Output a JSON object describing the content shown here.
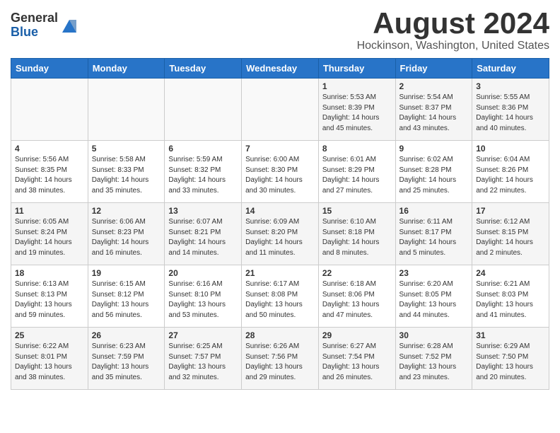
{
  "header": {
    "logo": {
      "general": "General",
      "blue": "Blue"
    },
    "title": "August 2024",
    "location": "Hockinson, Washington, United States"
  },
  "weekdays": [
    "Sunday",
    "Monday",
    "Tuesday",
    "Wednesday",
    "Thursday",
    "Friday",
    "Saturday"
  ],
  "weeks": [
    [
      {
        "day": "",
        "info": ""
      },
      {
        "day": "",
        "info": ""
      },
      {
        "day": "",
        "info": ""
      },
      {
        "day": "",
        "info": ""
      },
      {
        "day": "1",
        "info": "Sunrise: 5:53 AM\nSunset: 8:39 PM\nDaylight: 14 hours\nand 45 minutes."
      },
      {
        "day": "2",
        "info": "Sunrise: 5:54 AM\nSunset: 8:37 PM\nDaylight: 14 hours\nand 43 minutes."
      },
      {
        "day": "3",
        "info": "Sunrise: 5:55 AM\nSunset: 8:36 PM\nDaylight: 14 hours\nand 40 minutes."
      }
    ],
    [
      {
        "day": "4",
        "info": "Sunrise: 5:56 AM\nSunset: 8:35 PM\nDaylight: 14 hours\nand 38 minutes."
      },
      {
        "day": "5",
        "info": "Sunrise: 5:58 AM\nSunset: 8:33 PM\nDaylight: 14 hours\nand 35 minutes."
      },
      {
        "day": "6",
        "info": "Sunrise: 5:59 AM\nSunset: 8:32 PM\nDaylight: 14 hours\nand 33 minutes."
      },
      {
        "day": "7",
        "info": "Sunrise: 6:00 AM\nSunset: 8:30 PM\nDaylight: 14 hours\nand 30 minutes."
      },
      {
        "day": "8",
        "info": "Sunrise: 6:01 AM\nSunset: 8:29 PM\nDaylight: 14 hours\nand 27 minutes."
      },
      {
        "day": "9",
        "info": "Sunrise: 6:02 AM\nSunset: 8:28 PM\nDaylight: 14 hours\nand 25 minutes."
      },
      {
        "day": "10",
        "info": "Sunrise: 6:04 AM\nSunset: 8:26 PM\nDaylight: 14 hours\nand 22 minutes."
      }
    ],
    [
      {
        "day": "11",
        "info": "Sunrise: 6:05 AM\nSunset: 8:24 PM\nDaylight: 14 hours\nand 19 minutes."
      },
      {
        "day": "12",
        "info": "Sunrise: 6:06 AM\nSunset: 8:23 PM\nDaylight: 14 hours\nand 16 minutes."
      },
      {
        "day": "13",
        "info": "Sunrise: 6:07 AM\nSunset: 8:21 PM\nDaylight: 14 hours\nand 14 minutes."
      },
      {
        "day": "14",
        "info": "Sunrise: 6:09 AM\nSunset: 8:20 PM\nDaylight: 14 hours\nand 11 minutes."
      },
      {
        "day": "15",
        "info": "Sunrise: 6:10 AM\nSunset: 8:18 PM\nDaylight: 14 hours\nand 8 minutes."
      },
      {
        "day": "16",
        "info": "Sunrise: 6:11 AM\nSunset: 8:17 PM\nDaylight: 14 hours\nand 5 minutes."
      },
      {
        "day": "17",
        "info": "Sunrise: 6:12 AM\nSunset: 8:15 PM\nDaylight: 14 hours\nand 2 minutes."
      }
    ],
    [
      {
        "day": "18",
        "info": "Sunrise: 6:13 AM\nSunset: 8:13 PM\nDaylight: 13 hours\nand 59 minutes."
      },
      {
        "day": "19",
        "info": "Sunrise: 6:15 AM\nSunset: 8:12 PM\nDaylight: 13 hours\nand 56 minutes."
      },
      {
        "day": "20",
        "info": "Sunrise: 6:16 AM\nSunset: 8:10 PM\nDaylight: 13 hours\nand 53 minutes."
      },
      {
        "day": "21",
        "info": "Sunrise: 6:17 AM\nSunset: 8:08 PM\nDaylight: 13 hours\nand 50 minutes."
      },
      {
        "day": "22",
        "info": "Sunrise: 6:18 AM\nSunset: 8:06 PM\nDaylight: 13 hours\nand 47 minutes."
      },
      {
        "day": "23",
        "info": "Sunrise: 6:20 AM\nSunset: 8:05 PM\nDaylight: 13 hours\nand 44 minutes."
      },
      {
        "day": "24",
        "info": "Sunrise: 6:21 AM\nSunset: 8:03 PM\nDaylight: 13 hours\nand 41 minutes."
      }
    ],
    [
      {
        "day": "25",
        "info": "Sunrise: 6:22 AM\nSunset: 8:01 PM\nDaylight: 13 hours\nand 38 minutes."
      },
      {
        "day": "26",
        "info": "Sunrise: 6:23 AM\nSunset: 7:59 PM\nDaylight: 13 hours\nand 35 minutes."
      },
      {
        "day": "27",
        "info": "Sunrise: 6:25 AM\nSunset: 7:57 PM\nDaylight: 13 hours\nand 32 minutes."
      },
      {
        "day": "28",
        "info": "Sunrise: 6:26 AM\nSunset: 7:56 PM\nDaylight: 13 hours\nand 29 minutes."
      },
      {
        "day": "29",
        "info": "Sunrise: 6:27 AM\nSunset: 7:54 PM\nDaylight: 13 hours\nand 26 minutes."
      },
      {
        "day": "30",
        "info": "Sunrise: 6:28 AM\nSunset: 7:52 PM\nDaylight: 13 hours\nand 23 minutes."
      },
      {
        "day": "31",
        "info": "Sunrise: 6:29 AM\nSunset: 7:50 PM\nDaylight: 13 hours\nand 20 minutes."
      }
    ]
  ]
}
